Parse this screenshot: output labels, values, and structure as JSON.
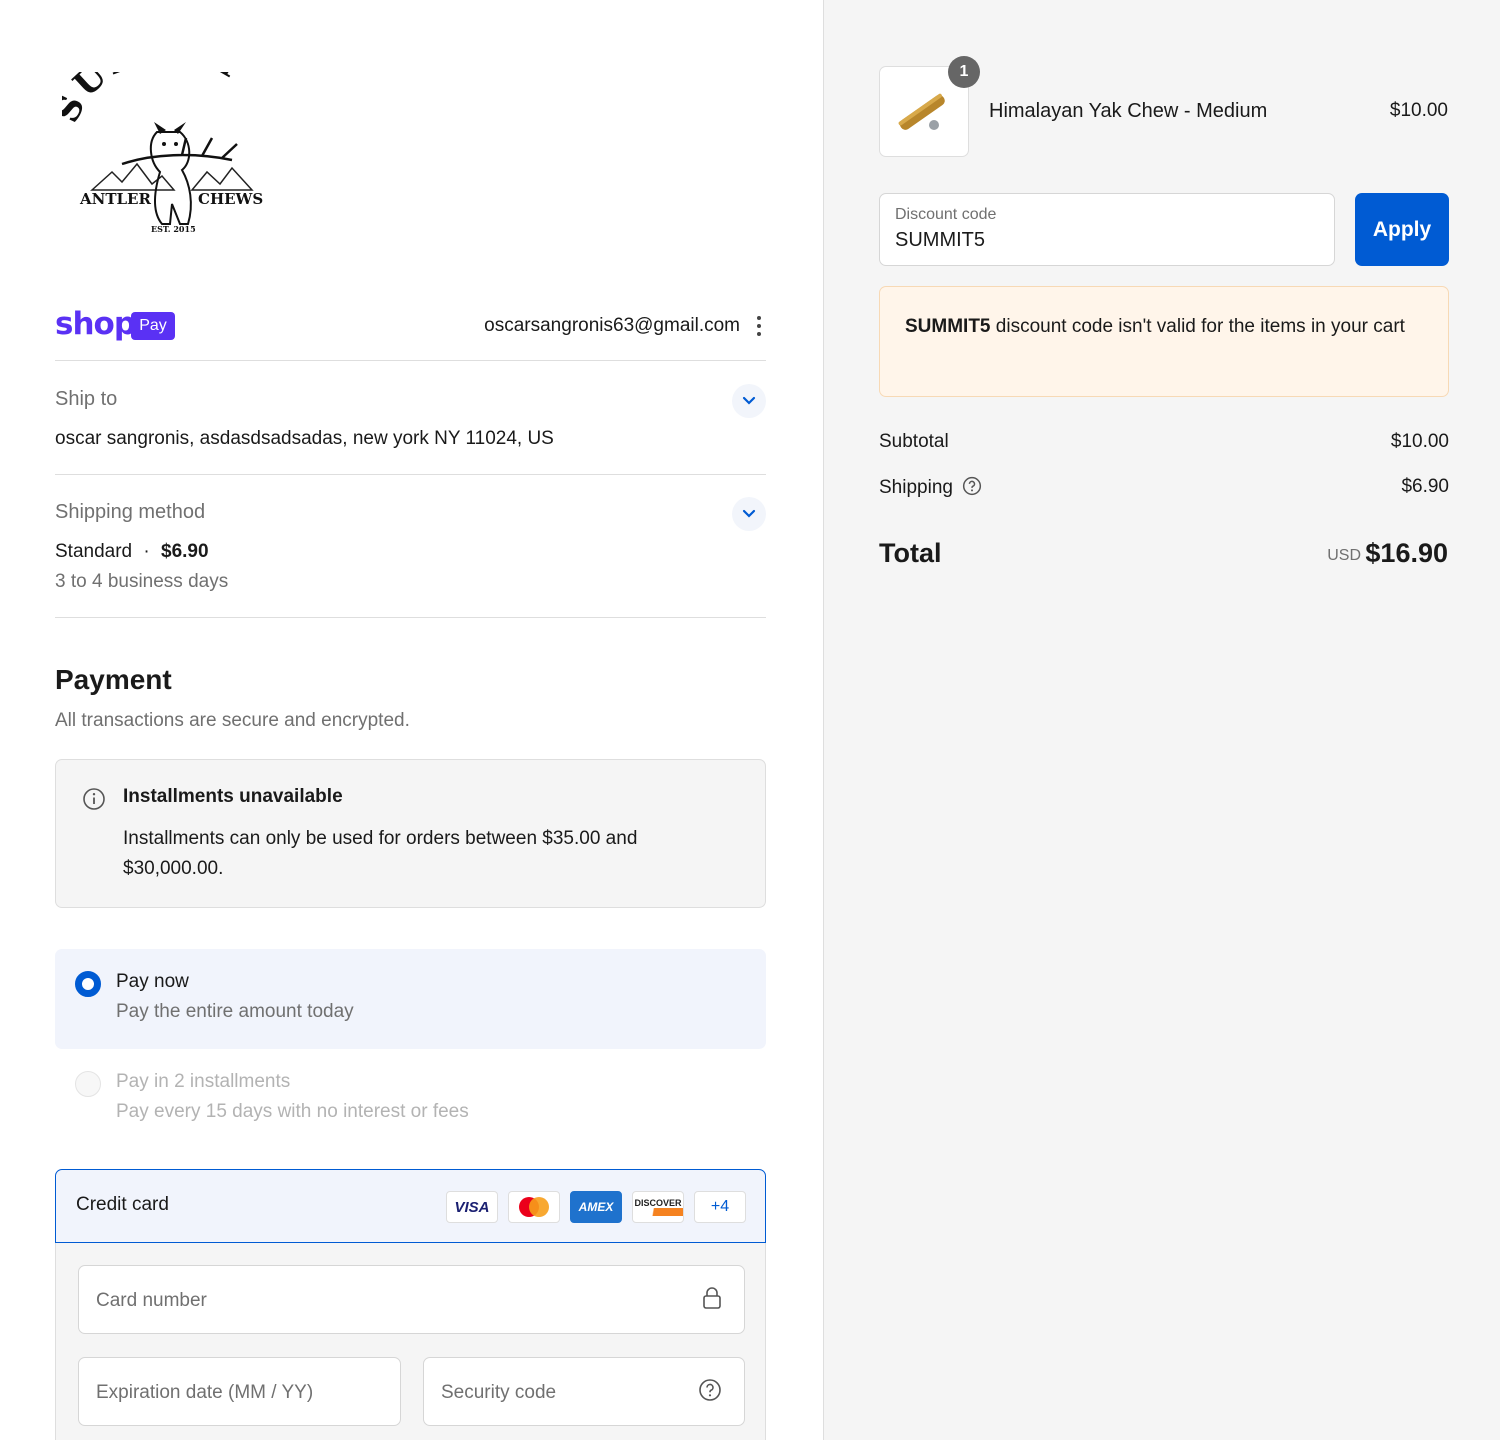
{
  "brand": {
    "logo_top": "SUMMIT",
    "logo_left": "ANTLER",
    "logo_right": "CHEWS",
    "logo_est": "EST. 2015"
  },
  "shop_pay": {
    "wordmark": "shop",
    "pill": "Pay",
    "email": "oscarsangronis63@gmail.com"
  },
  "ship_to": {
    "label": "Ship to",
    "value": "oscar sangronis, asdasdsadsadas, new york NY 11024, US"
  },
  "shipping_method": {
    "label": "Shipping method",
    "name": "Standard",
    "separator": "·",
    "price": "$6.90",
    "eta": "3 to 4 business days"
  },
  "payment": {
    "title": "Payment",
    "subtitle": "All transactions are secure and encrypted.",
    "installments_notice": {
      "title": "Installments unavailable",
      "text": "Installments can only be used for orders between $35.00 and $30,000.00."
    },
    "options": [
      {
        "title": "Pay now",
        "subtitle": "Pay the entire amount today",
        "selected": true
      },
      {
        "title": "Pay in 2 installments",
        "subtitle": "Pay every 15 days with no interest or fees",
        "selected": false
      }
    ],
    "credit_card": {
      "label": "Credit card",
      "brands": [
        "VISA",
        "Mastercard",
        "AMEX",
        "DISCOVER"
      ],
      "more": "+4",
      "fields": {
        "card_number": "Card number",
        "expiration": "Expiration date (MM / YY)",
        "security": "Security code"
      }
    }
  },
  "summary": {
    "item": {
      "qty": "1",
      "name": "Himalayan Yak Chew - Medium",
      "price": "$10.00"
    },
    "discount": {
      "label": "Discount code",
      "value": "SUMMIT5",
      "button": "Apply"
    },
    "warning": {
      "code": "SUMMIT5",
      "text": " discount code isn't valid for the items in your cart"
    },
    "subtotal": {
      "label": "Subtotal",
      "value": "$10.00"
    },
    "shipping": {
      "label": "Shipping",
      "value": "$6.90"
    },
    "total": {
      "label": "Total",
      "currency": "USD",
      "value": "$16.90"
    }
  },
  "colors": {
    "accent": "#005bd3",
    "shop_purple": "#5a31f4",
    "warning_bg": "#fff5ea",
    "sidebar_bg": "#f5f5f5"
  }
}
